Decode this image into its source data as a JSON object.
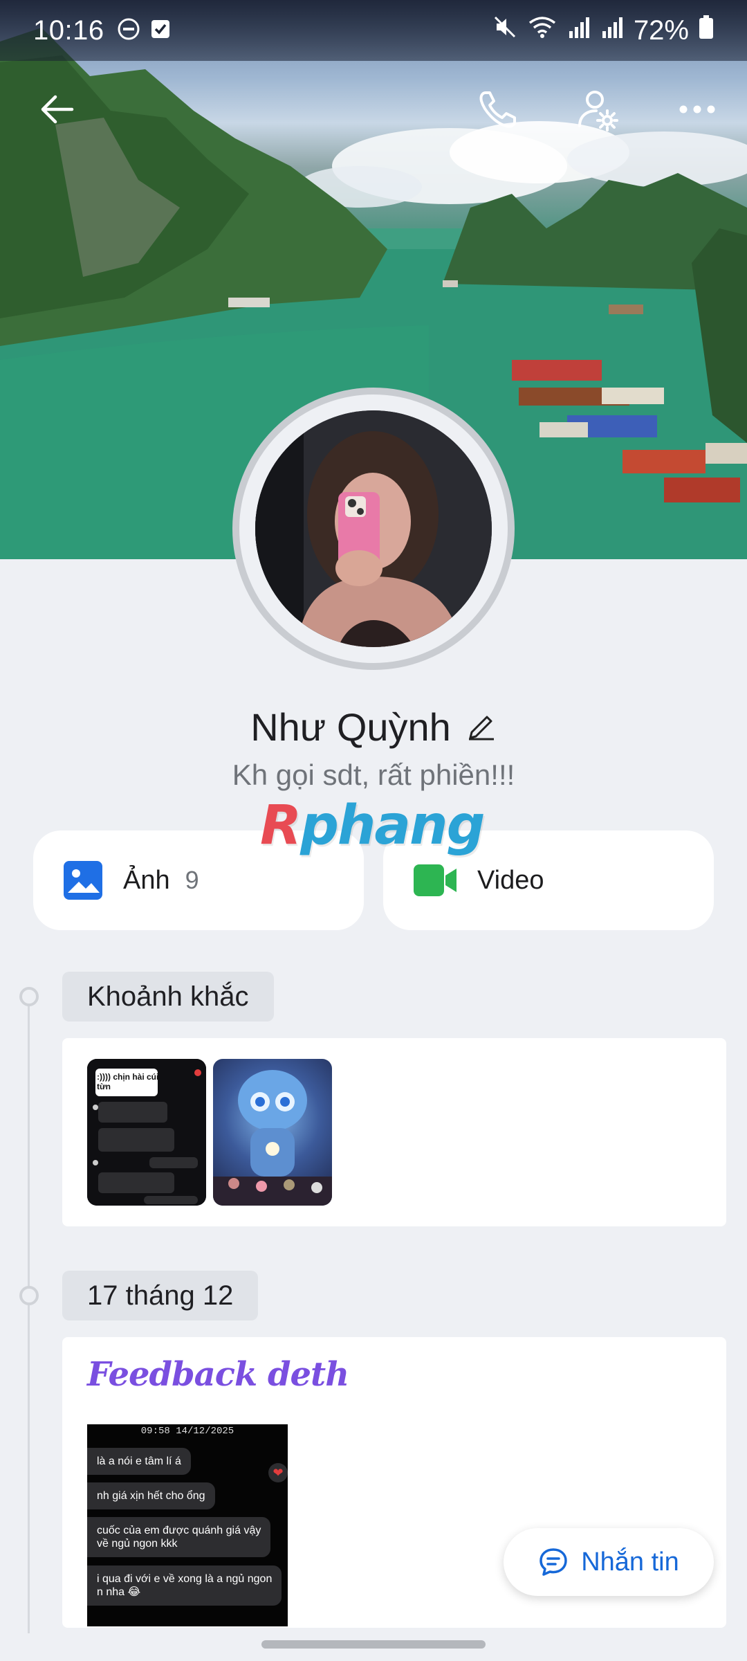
{
  "status_bar": {
    "time": "10:16",
    "battery": "72%"
  },
  "profile": {
    "name": "Như Quỳnh",
    "bio": "Kh gọi sdt, rất phiền!!!"
  },
  "watermark": {
    "prefix": "R",
    "rest": "phang"
  },
  "media": {
    "photos_label": "Ảnh",
    "photos_count": "9",
    "video_label": "Video"
  },
  "timeline": {
    "moments_label": "Khoảnh khắc",
    "date_label": "17 tháng 12",
    "post_title": "Feedback deth",
    "chat_thumb_caption": ":)))) chịn hài cúi từn",
    "shot_time": "09:58 14/12/2025",
    "shot_messages": [
      "là a nói e tâm lí á",
      "nh giá xịn hết cho ổng",
      "cuốc của em được quánh giá vậy\nvề ngủ ngon kkk",
      "i qua đi với e về xong là a ngủ ngon\nn nha 😂"
    ]
  },
  "message_button": {
    "label": "Nhắn tin"
  },
  "colors": {
    "accent_blue": "#1668d8",
    "video_green": "#2db552",
    "photo_blue": "#1f6fe5",
    "feedback_purple": "#7a4fe0"
  },
  "icons": {
    "back": "arrow-left-icon",
    "call": "phone-icon",
    "profile_settings": "person-gear-icon",
    "more": "more-horizontal-icon",
    "edit": "pencil-icon",
    "photos": "image-icon",
    "video": "video-camera-icon",
    "message": "chat-bubble-icon"
  }
}
